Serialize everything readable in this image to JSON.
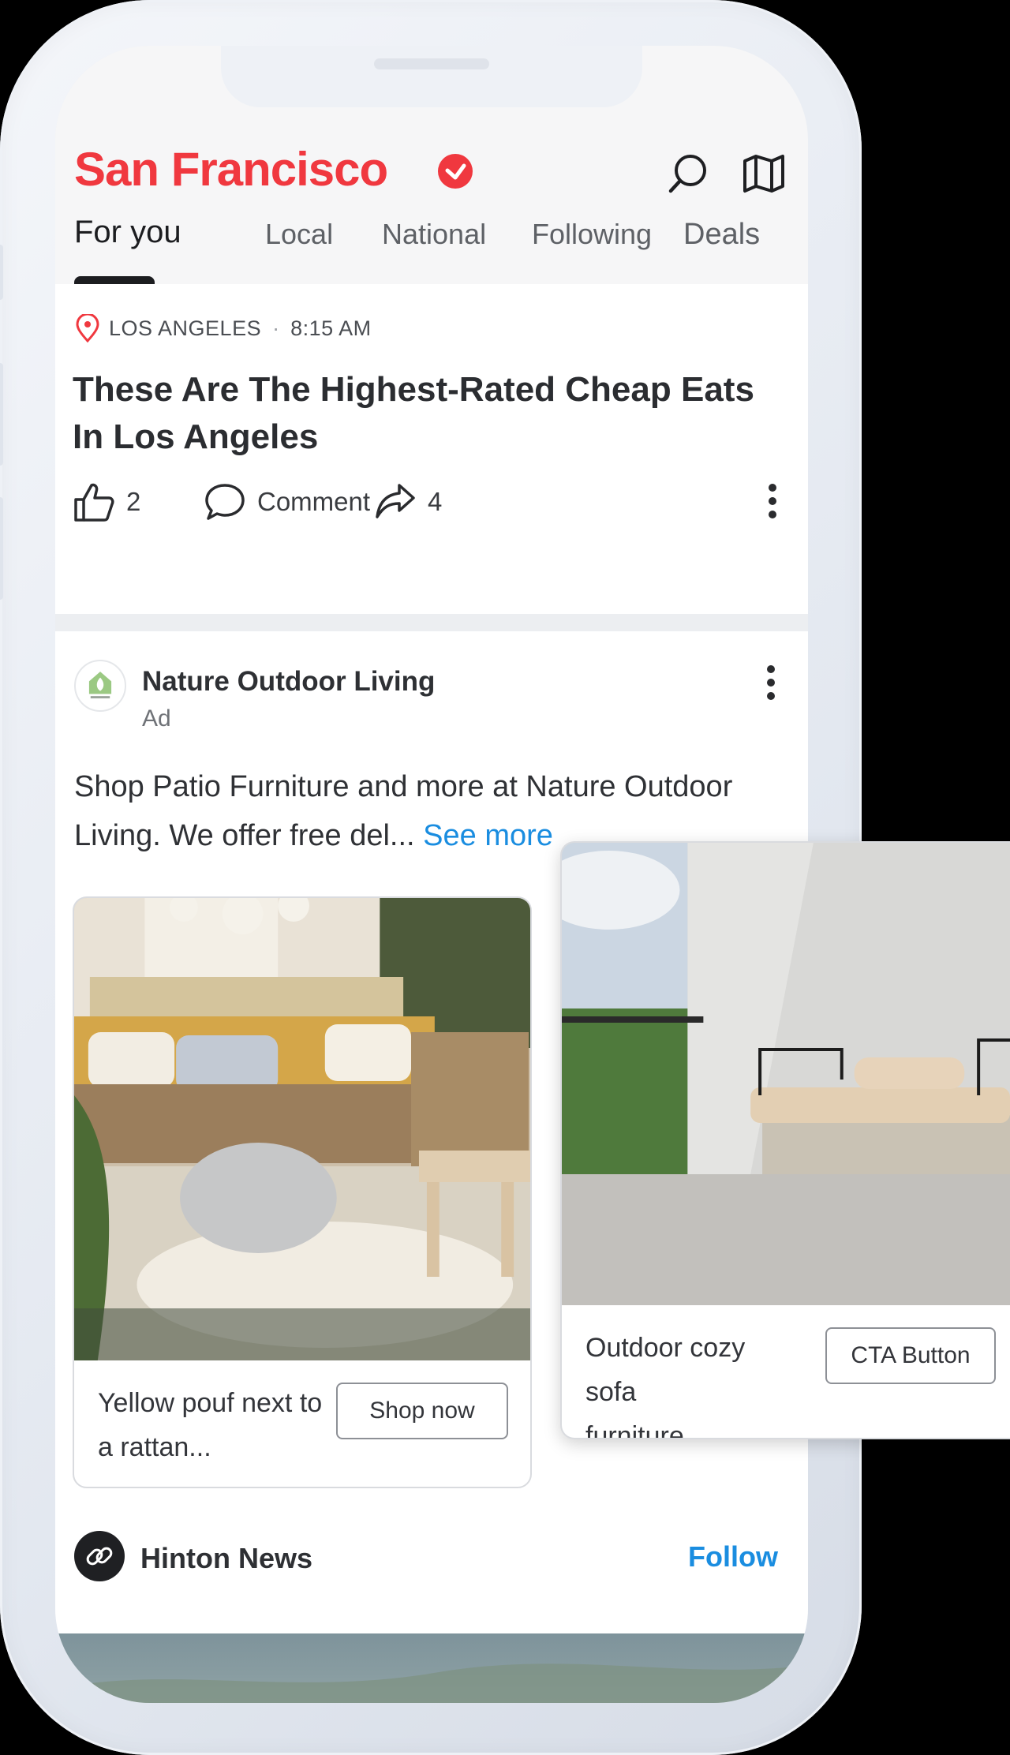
{
  "header": {
    "city": "San Francisco",
    "tabs": [
      "For you",
      "Local",
      "National",
      "Following",
      "Deals"
    ],
    "active_tab": "For you"
  },
  "article": {
    "location": "LOS ANGELES",
    "separator": "·",
    "time": "8:15 AM",
    "headline": "These Are The Highest-Rated Cheap Eats In Los Angeles",
    "likes": "2",
    "comment_label": "Comment",
    "shares": "4"
  },
  "ad": {
    "brand": "Nature Outdoor Living",
    "label": "Ad",
    "text": "Shop Patio Furniture and more at Nature Outdoor Living. We offer free del...",
    "see_more": "See more",
    "products": [
      {
        "caption": "Yellow pouf next to a rattan...",
        "cta": "Shop now"
      },
      {
        "caption": "Outdoor cozy sofa furniture...",
        "cta": "CTA Button"
      }
    ]
  },
  "source": {
    "name": "Hinton News",
    "follow": "Follow"
  },
  "colors": {
    "brand_red": "#f0383f",
    "link_blue": "#1a8de0",
    "text_dark": "#2b2d31"
  },
  "icons": [
    "verified-check-icon",
    "search-icon",
    "map-icon",
    "location-pin-icon",
    "thumbs-up-icon",
    "comment-icon",
    "share-icon",
    "more-options-icon",
    "link-icon"
  ]
}
